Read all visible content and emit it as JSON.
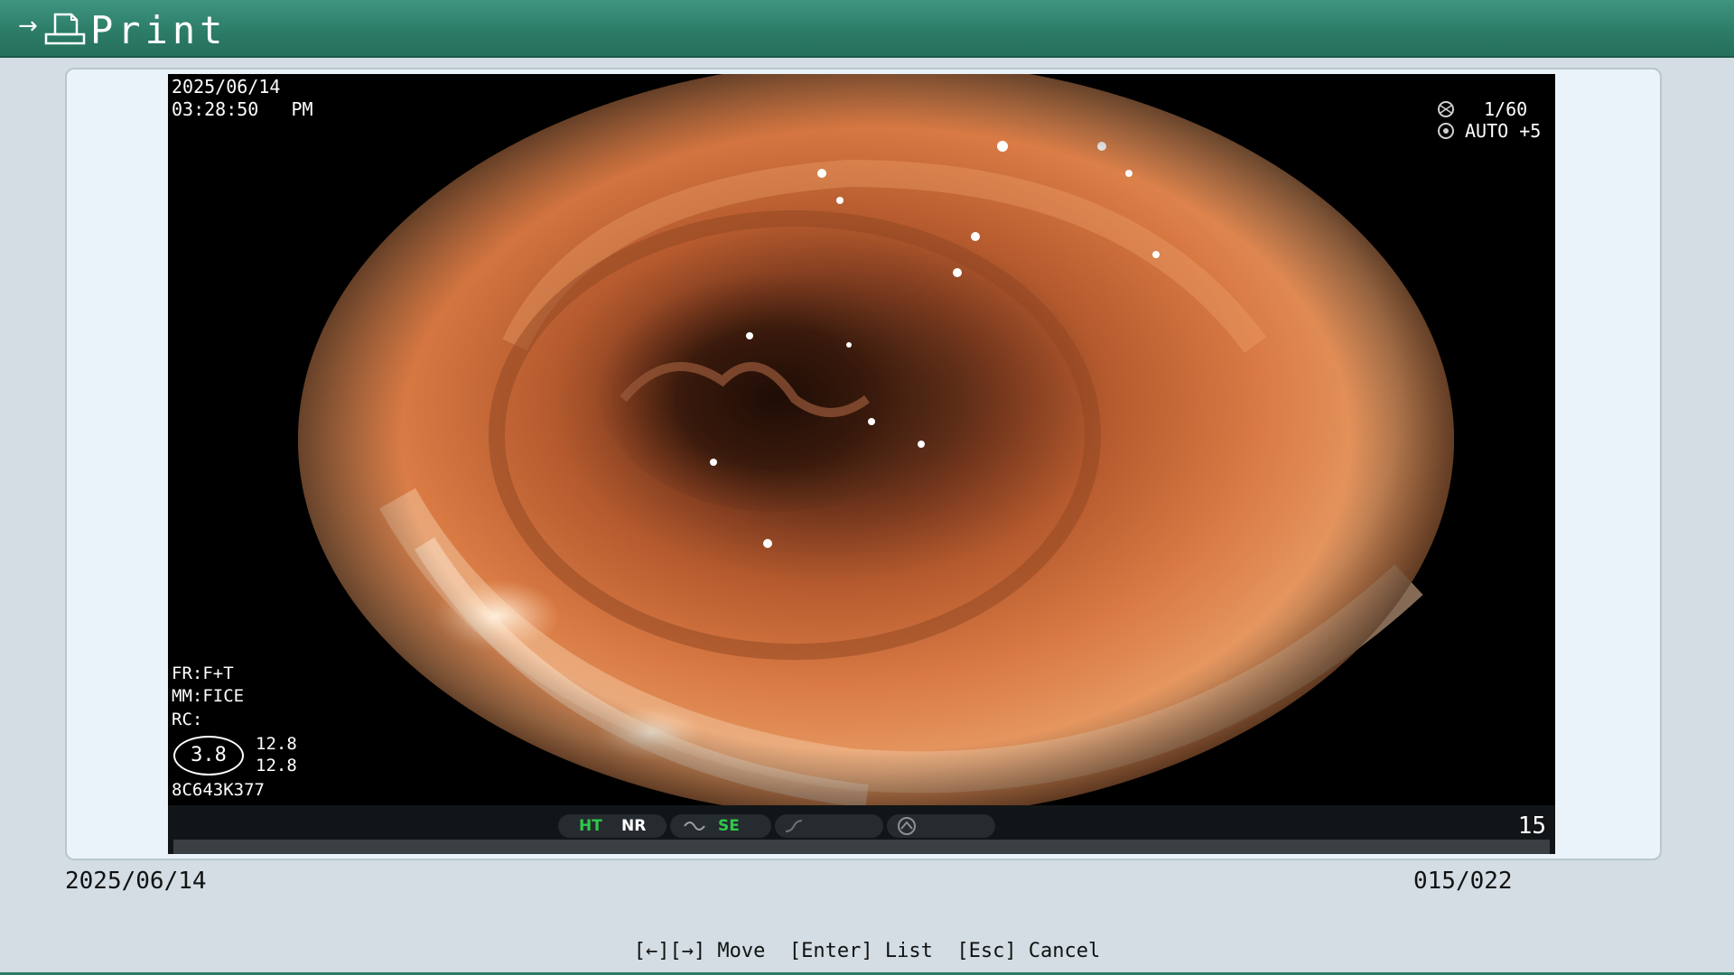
{
  "titlebar": {
    "arrow": "→",
    "title": "Print",
    "icon": "print-document-icon"
  },
  "image": {
    "date": "2025/06/14",
    "time": "03:28:50   PM",
    "shutter_icon": "shutter-icon",
    "shutter": "1/60",
    "iris_icon": "iris-icon",
    "iris": "AUTO +5",
    "fr": "FR:F+T",
    "mm": "MM:FICE",
    "rc": "RC:",
    "circle_value": "3.8",
    "value_a": "12.8",
    "value_b": "12.8",
    "scope_id": "8C643K377"
  },
  "status": {
    "ht": "HT",
    "nr": "NR",
    "se": "SE",
    "ht_color": "#2fc94a",
    "se_color": "#2fc94a",
    "page": "15"
  },
  "footer": {
    "date": "2025/06/14",
    "counter": "015/022"
  },
  "keyhints": "[←][→] Move  [Enter] List  [Esc] Cancel"
}
